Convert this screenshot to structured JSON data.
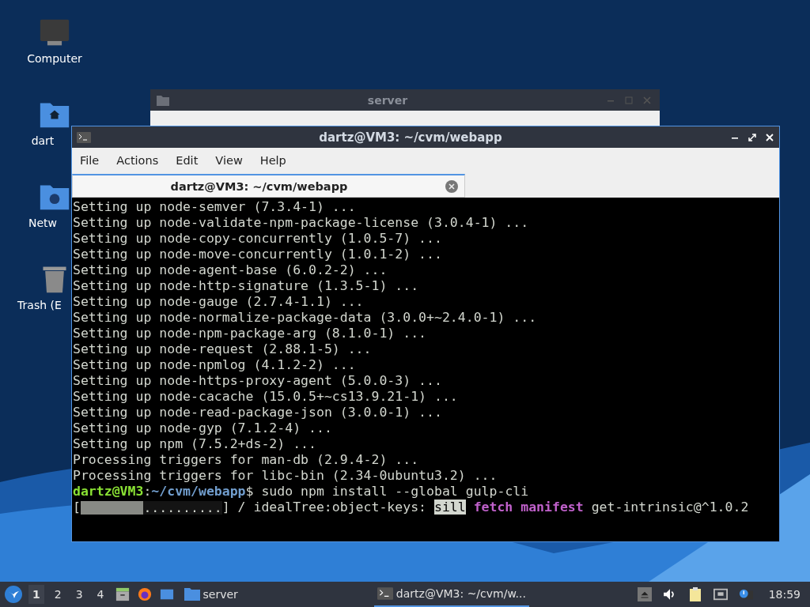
{
  "desktop_icons": [
    {
      "kind": "computer",
      "label": "Computer"
    },
    {
      "kind": "home",
      "label": "dart"
    },
    {
      "kind": "network",
      "label": "Netw"
    },
    {
      "kind": "trash",
      "label": "Trash (E"
    }
  ],
  "back_window": {
    "title": "server"
  },
  "terminal": {
    "title": "dartz@VM3: ~/cvm/webapp",
    "menu": [
      "File",
      "Actions",
      "Edit",
      "View",
      "Help"
    ],
    "tabs": [
      {
        "label": "dartz@VM3: ~/cvm/webapp",
        "selected": true
      }
    ],
    "lines": [
      {
        "segments": [
          {
            "kind": "text",
            "text": "Setting up node-semver (7.3.4-1) ..."
          }
        ]
      },
      {
        "segments": [
          {
            "kind": "text",
            "text": "Setting up node-validate-npm-package-license (3.0.4-1) ..."
          }
        ]
      },
      {
        "segments": [
          {
            "kind": "text",
            "text": "Setting up node-copy-concurrently (1.0.5-7) ..."
          }
        ]
      },
      {
        "segments": [
          {
            "kind": "text",
            "text": "Setting up node-move-concurrently (1.0.1-2) ..."
          }
        ]
      },
      {
        "segments": [
          {
            "kind": "text",
            "text": "Setting up node-agent-base (6.0.2-2) ..."
          }
        ]
      },
      {
        "segments": [
          {
            "kind": "text",
            "text": "Setting up node-http-signature (1.3.5-1) ..."
          }
        ]
      },
      {
        "segments": [
          {
            "kind": "text",
            "text": "Setting up node-gauge (2.7.4-1.1) ..."
          }
        ]
      },
      {
        "segments": [
          {
            "kind": "text",
            "text": "Setting up node-normalize-package-data (3.0.0+~2.4.0-1) ..."
          }
        ]
      },
      {
        "segments": [
          {
            "kind": "text",
            "text": "Setting up node-npm-package-arg (8.1.0-1) ..."
          }
        ]
      },
      {
        "segments": [
          {
            "kind": "text",
            "text": "Setting up node-request (2.88.1-5) ..."
          }
        ]
      },
      {
        "segments": [
          {
            "kind": "text",
            "text": "Setting up node-npmlog (4.1.2-2) ..."
          }
        ]
      },
      {
        "segments": [
          {
            "kind": "text",
            "text": "Setting up node-https-proxy-agent (5.0.0-3) ..."
          }
        ]
      },
      {
        "segments": [
          {
            "kind": "text",
            "text": "Setting up node-cacache (15.0.5+~cs13.9.21-1) ..."
          }
        ]
      },
      {
        "segments": [
          {
            "kind": "text",
            "text": "Setting up node-read-package-json (3.0.0-1) ..."
          }
        ]
      },
      {
        "segments": [
          {
            "kind": "text",
            "text": "Setting up node-gyp (7.1.2-4) ..."
          }
        ]
      },
      {
        "segments": [
          {
            "kind": "text",
            "text": "Setting up npm (7.5.2+ds-2) ..."
          }
        ]
      },
      {
        "segments": [
          {
            "kind": "text",
            "text": "Processing triggers for man-db (2.9.4-2) ..."
          }
        ]
      },
      {
        "segments": [
          {
            "kind": "text",
            "text": "Processing triggers for libc-bin (2.34-0ubuntu3.2) ..."
          }
        ]
      },
      {
        "segments": [
          {
            "kind": "text",
            "text": "dartz@VM3",
            "color": "#8ae234"
          },
          {
            "kind": "text",
            "text": ":"
          },
          {
            "kind": "text",
            "text": "~/cvm/webapp",
            "color": "#729fcf"
          },
          {
            "kind": "text",
            "text": "$ sudo npm install --global gulp-cli"
          }
        ]
      },
      {
        "segments": [
          {
            "kind": "text",
            "text": "["
          },
          {
            "kind": "bar",
            "level": 0.44,
            "text": ".........."
          },
          {
            "kind": "text",
            "text": "] / idealTree:object-keys: "
          },
          {
            "kind": "highlight",
            "text": "sill"
          },
          {
            "kind": "text",
            "text": " fetch manifest",
            "color": "#c061cb"
          },
          {
            "kind": "text",
            "text": " get-intrinsic@^1.0.2"
          }
        ]
      }
    ]
  },
  "taskbar": {
    "workspaces": [
      {
        "label": "1",
        "selected": true
      },
      {
        "label": "2",
        "selected": false
      },
      {
        "label": "3",
        "selected": false
      },
      {
        "label": "4",
        "selected": false
      }
    ],
    "tasks": [
      {
        "kind": "folder",
        "label": "server",
        "selected": false
      },
      {
        "kind": "terminal",
        "label": "dartz@VM3: ~/cvm/w...",
        "selected": true
      }
    ],
    "clock": "18:59"
  }
}
